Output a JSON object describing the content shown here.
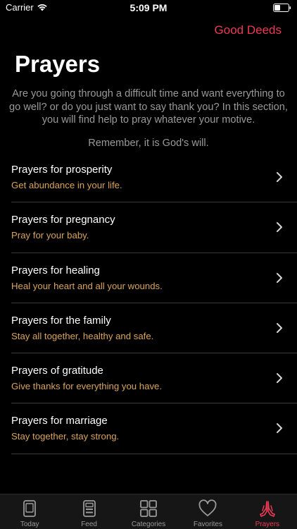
{
  "status_bar": {
    "carrier": "Carrier",
    "time": "5:09 PM"
  },
  "nav": {
    "action_label": "Good Deeds"
  },
  "page": {
    "title": "Prayers",
    "intro": "Are you going through a difficult time and want everything to go well? or do you just want to say thank you? In this section, you will find help to pray whatever your motive.",
    "remember": "Remember, it is God's will."
  },
  "prayers": [
    {
      "title": "Prayers for prosperity",
      "subtitle": "Get abundance in your life."
    },
    {
      "title": "Prayers for pregnancy",
      "subtitle": "Pray for your baby."
    },
    {
      "title": "Prayers for healing",
      "subtitle": "Heal your heart and all your wounds."
    },
    {
      "title": "Prayers for the family",
      "subtitle": "Stay all together, healthy and safe."
    },
    {
      "title": "Prayers of gratitude",
      "subtitle": "Give thanks for everything you have."
    },
    {
      "title": "Prayers for marriage",
      "subtitle": "Stay together, stay strong."
    }
  ],
  "tabbar": {
    "items": [
      {
        "label": "Today",
        "icon": "book-icon"
      },
      {
        "label": "Feed",
        "icon": "document-icon"
      },
      {
        "label": "Categories",
        "icon": "grid-icon"
      },
      {
        "label": "Favorites",
        "icon": "heart-icon"
      },
      {
        "label": "Prayers",
        "icon": "praying-hands-icon",
        "active": true
      }
    ]
  },
  "colors": {
    "accent": "#ec3a56",
    "subtitle": "#d9a45c",
    "background": "#000000",
    "tabbar": "#161616"
  }
}
